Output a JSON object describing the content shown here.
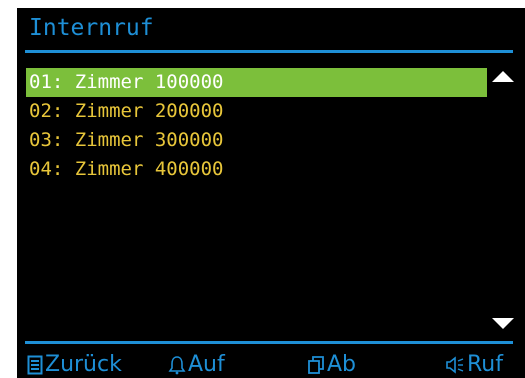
{
  "header": {
    "title": "Internruf"
  },
  "list": {
    "items": [
      {
        "label": "01: Zimmer 100000",
        "selected": true
      },
      {
        "label": "02: Zimmer 200000",
        "selected": false
      },
      {
        "label": "03: Zimmer 300000",
        "selected": false
      },
      {
        "label": "04: Zimmer 400000",
        "selected": false
      }
    ]
  },
  "softkeys": {
    "back": {
      "label": "Zurück",
      "icon": "menu-list-icon"
    },
    "up": {
      "label": "Auf",
      "icon": "bell-icon"
    },
    "down": {
      "label": "Ab",
      "icon": "copy-icon"
    },
    "call": {
      "label": "Ruf",
      "icon": "speaker-icon"
    }
  },
  "colors": {
    "accent": "#1e8fd6",
    "item_text": "#e8c63a",
    "selection": "#7cbf3b",
    "background": "#000000"
  }
}
